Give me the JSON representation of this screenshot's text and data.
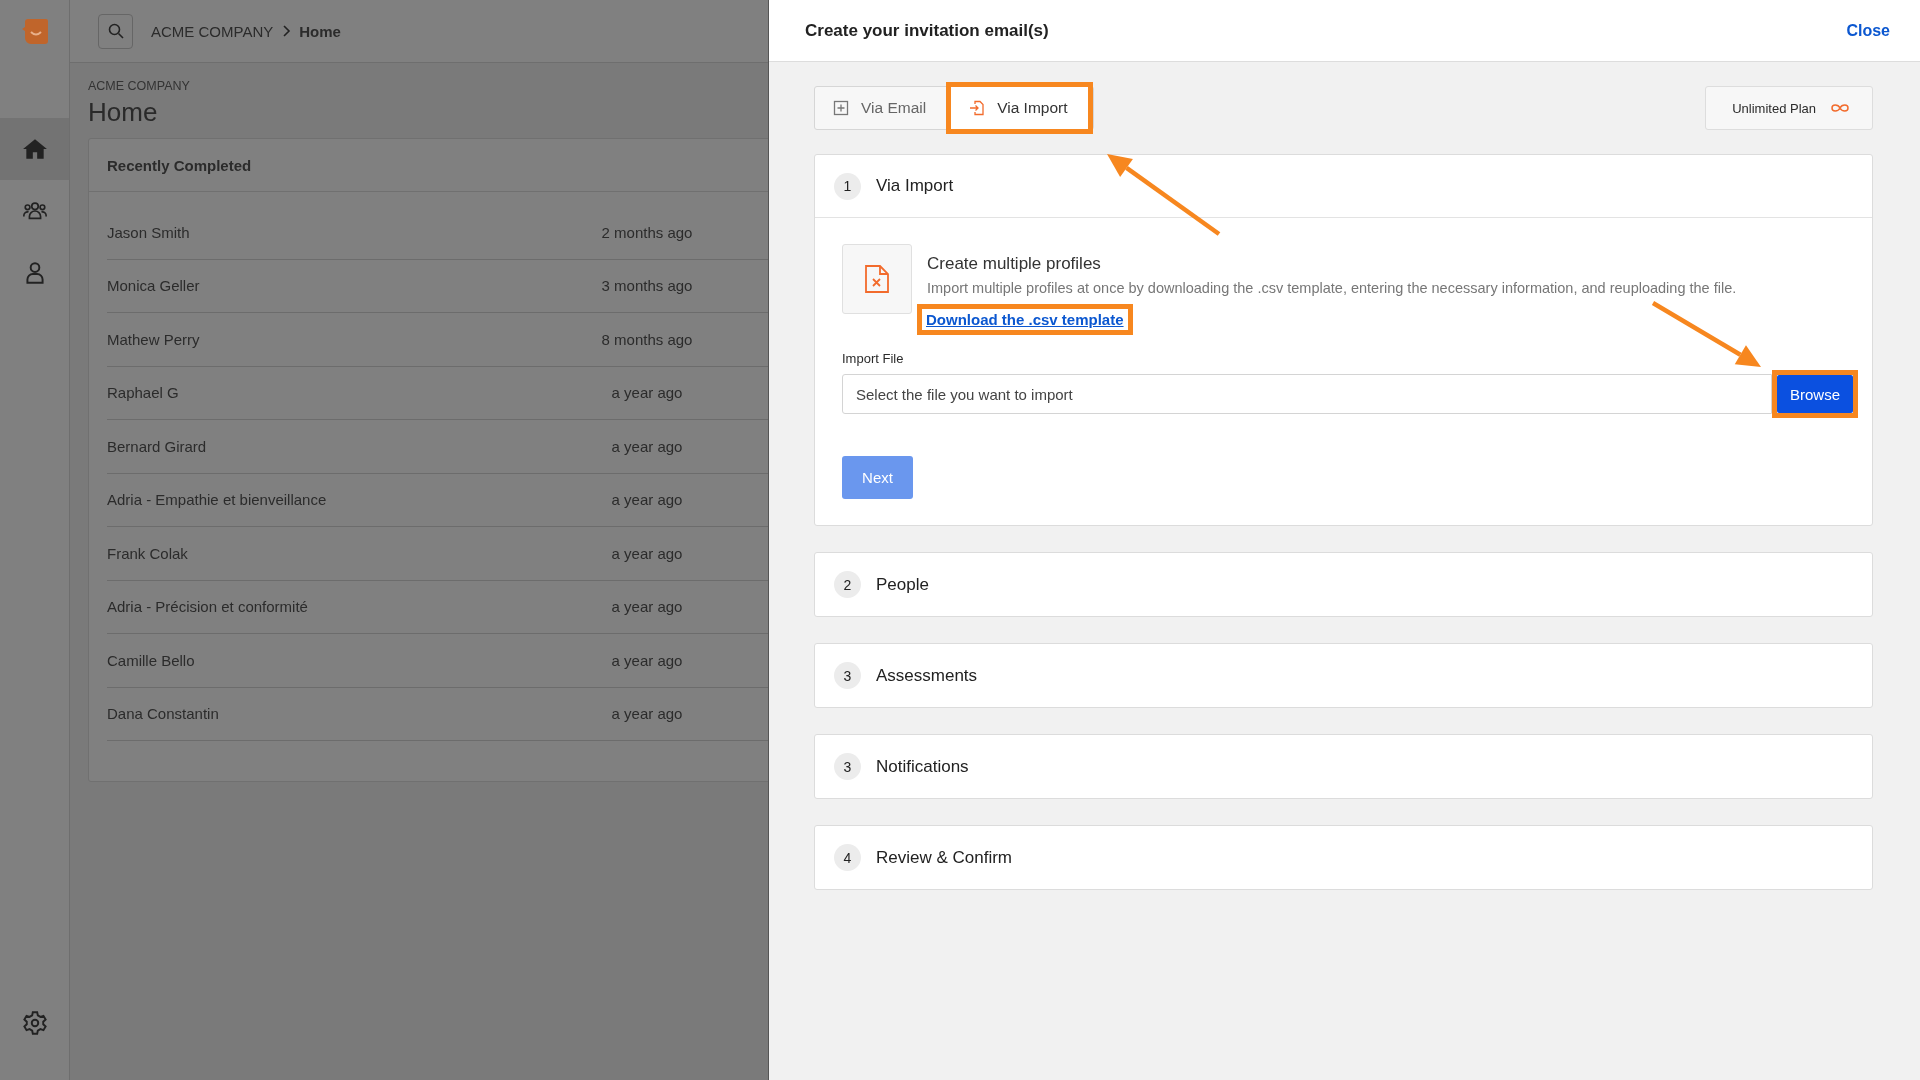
{
  "sidebar": {
    "items": [
      {
        "kind": "home",
        "selected": true
      },
      {
        "kind": "people",
        "selected": false
      },
      {
        "kind": "person",
        "selected": false
      }
    ],
    "footer_items": [
      {
        "kind": "settings",
        "selected": false
      }
    ]
  },
  "topbar": {
    "breadcrumb": [
      {
        "label": "ACME COMPANY",
        "current": false
      },
      {
        "label": "Home",
        "current": true
      }
    ]
  },
  "page": {
    "overline": "ACME COMPANY",
    "title": "Home"
  },
  "recent": {
    "title": "Recently Completed",
    "rows": [
      {
        "name": "Jason Smith",
        "time": "2 months ago"
      },
      {
        "name": "Monica Geller",
        "time": "3 months ago"
      },
      {
        "name": "Mathew Perry",
        "time": "8 months ago"
      },
      {
        "name": "Raphael G",
        "time": "a year ago"
      },
      {
        "name": "Bernard Girard",
        "time": "a year ago"
      },
      {
        "name": "Adria - Empathie et bienveillance",
        "time": "a year ago"
      },
      {
        "name": "Frank Colak",
        "time": "a year ago"
      },
      {
        "name": "Adria - Précision et conformité",
        "time": "a year ago"
      },
      {
        "name": "Camille Bello",
        "time": "a year ago"
      },
      {
        "name": "Dana Constantin",
        "time": "a year ago"
      }
    ]
  },
  "drawer": {
    "title": "Create your invitation email(s)",
    "close": "Close",
    "tabs": [
      {
        "label": "Via Email",
        "kind": "email",
        "selected": false,
        "highlighted": false,
        "arrow": false
      },
      {
        "label": "Via Import",
        "kind": "import",
        "selected": true,
        "highlighted": true,
        "arrow": true
      }
    ],
    "plan": {
      "label": "Unlimited Plan"
    },
    "steps": [
      {
        "number": "1",
        "title": "Via Import",
        "expanded": true
      },
      {
        "number": "2",
        "title": "People",
        "expanded": false
      },
      {
        "number": "3",
        "title": "Assessments",
        "expanded": false
      },
      {
        "number": "3",
        "title": "Notifications",
        "expanded": false
      },
      {
        "number": "4",
        "title": "Review & Confirm",
        "expanded": false
      }
    ],
    "import": {
      "heading": "Create multiple profiles",
      "description": "Import multiple profiles at once by downloading the .csv template, entering the necessary information, and reuploading the file.",
      "link": {
        "label": "Download the .csv template",
        "highlighted": true
      },
      "file_label": "Import File",
      "file_placeholder": "Select the file you want to import",
      "browse": {
        "label": "Browse",
        "highlighted": true,
        "arrow": true
      },
      "next": {
        "label": "Next",
        "disabled": true
      }
    }
  }
}
